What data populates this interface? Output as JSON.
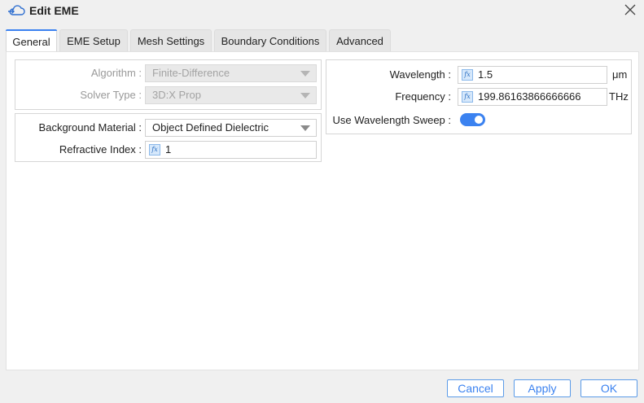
{
  "window": {
    "title": "Edit EME",
    "icon": "cloud-arrow-icon",
    "close_icon": "close-icon"
  },
  "tabs": [
    {
      "label": "General",
      "active": true
    },
    {
      "label": "EME Setup",
      "active": false
    },
    {
      "label": "Mesh Settings",
      "active": false
    },
    {
      "label": "Boundary Conditions",
      "active": false
    },
    {
      "label": "Advanced",
      "active": false
    }
  ],
  "solver": {
    "algorithm_label": "Algorithm :",
    "algorithm_value": "Finite-Difference",
    "solver_type_label": "Solver Type :",
    "solver_type_value": "3D:X Prop"
  },
  "material": {
    "background_label": "Background Material :",
    "background_value": "Object Defined Dielectric",
    "refractive_label": "Refractive Index :",
    "refractive_value": "1"
  },
  "source": {
    "wavelength_label": "Wavelength :",
    "wavelength_value": "1.5",
    "wavelength_unit": "μm",
    "frequency_label": "Frequency :",
    "frequency_value": "199.86163866666666",
    "frequency_unit": "THz",
    "sweep_label": "Use Wavelength Sweep :",
    "sweep_enabled": true
  },
  "fx_badge": "fx",
  "footer": {
    "cancel_label": "Cancel",
    "apply_label": "Apply",
    "ok_label": "OK"
  },
  "colors": {
    "accent": "#3b82f0",
    "disabled_bg": "#e9e9e9",
    "fx_bg": "#d6e8fb"
  }
}
